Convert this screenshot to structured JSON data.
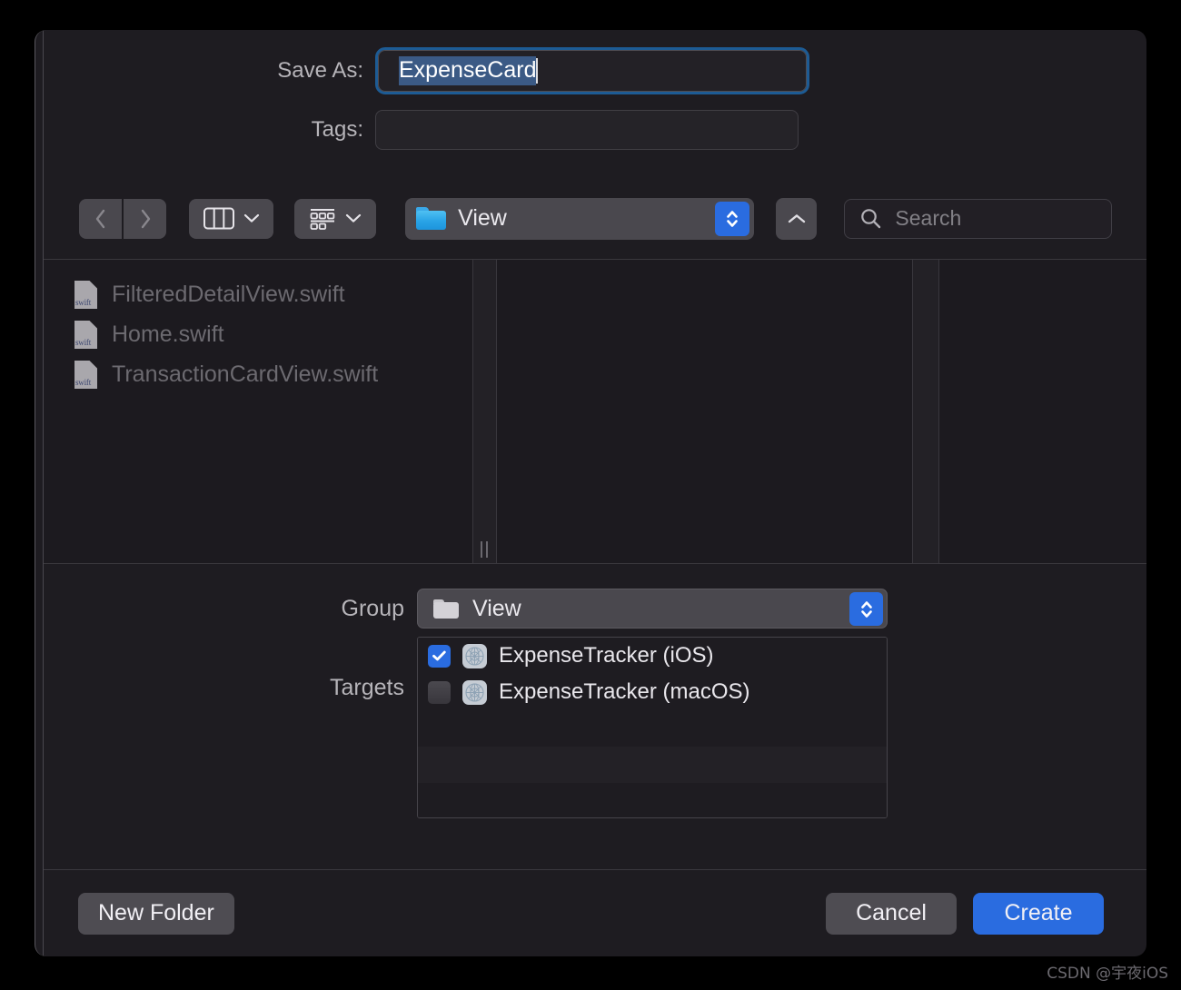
{
  "dialog": {
    "save_as": {
      "label": "Save As:",
      "value": "ExpenseCard",
      "selected": true
    },
    "tags": {
      "label": "Tags:",
      "value": "",
      "placeholder": ""
    }
  },
  "toolbar": {
    "back_icon": "chevron-left-icon",
    "forward_icon": "chevron-right-icon",
    "view_mode_icon": "column-view-icon",
    "group_by_icon": "group-by-icon",
    "path_popup_label": "View",
    "path_popup_icon": "folder-blue-icon",
    "up_icon": "chevron-up-icon",
    "search": {
      "icon": "search-icon",
      "placeholder": "Search",
      "value": ""
    }
  },
  "browser": {
    "files": [
      {
        "name": "FilteredDetailView.swift",
        "icon": "swift-file-icon",
        "ext": "swift"
      },
      {
        "name": "Home.swift",
        "icon": "swift-file-icon",
        "ext": "swift"
      },
      {
        "name": "TransactionCardView.swift",
        "icon": "swift-file-icon",
        "ext": "swift"
      }
    ]
  },
  "options": {
    "group": {
      "label": "Group",
      "value": "View",
      "icon": "folder-gray-icon"
    },
    "targets": {
      "label": "Targets",
      "items": [
        {
          "name": "ExpenseTracker (iOS)",
          "checked": true,
          "icon": "target-icon"
        },
        {
          "name": "ExpenseTracker (macOS)",
          "checked": false,
          "icon": "target-icon"
        }
      ]
    }
  },
  "footer": {
    "new_folder_label": "New Folder",
    "cancel_label": "Cancel",
    "create_label": "Create"
  },
  "watermark": "CSDN @宇夜iOS",
  "colors": {
    "accent_blue": "#2a6ce0",
    "focus_ring": "#1d5b94",
    "selection_blue": "#3b5a85",
    "dialog_bg": "#1e1c21",
    "control_gray": "#4a484e"
  }
}
